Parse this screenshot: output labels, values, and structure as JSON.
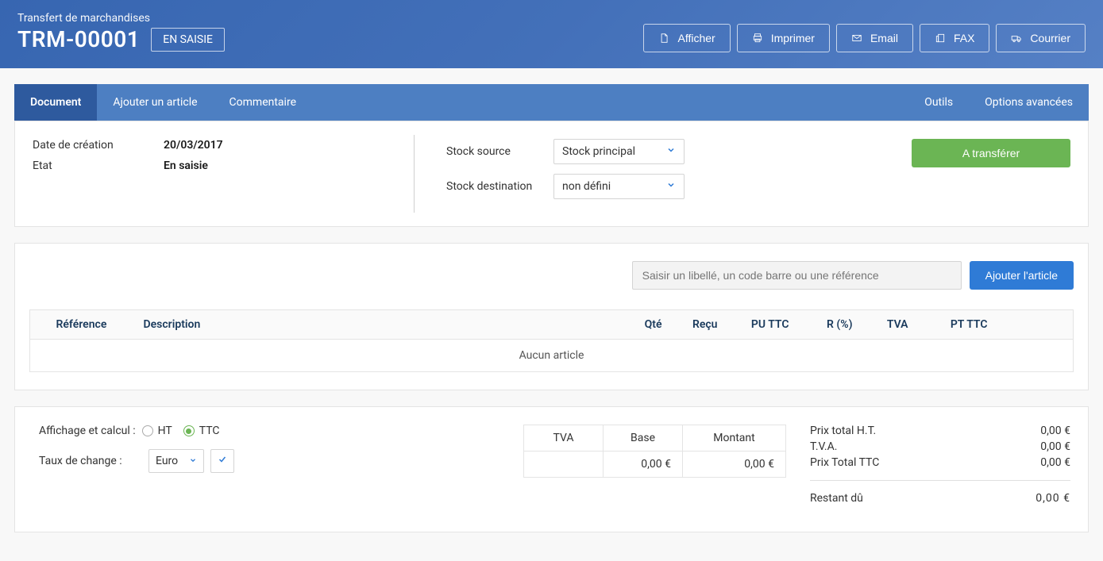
{
  "header": {
    "subtitle": "Transfert de marchandises",
    "title": "TRM-00001",
    "status": "EN SAISIE",
    "actions": {
      "afficher": "Afficher",
      "imprimer": "Imprimer",
      "email": "Email",
      "fax": "FAX",
      "courrier": "Courrier"
    }
  },
  "tabs": {
    "document": "Document",
    "ajouter": "Ajouter un article",
    "commentaire": "Commentaire",
    "outils": "Outils",
    "options": "Options avancées"
  },
  "info": {
    "date_label": "Date de création",
    "date_value": "20/03/2017",
    "etat_label": "Etat",
    "etat_value": "En saisie"
  },
  "stock": {
    "source_label": "Stock source",
    "source_value": "Stock principal",
    "dest_label": "Stock destination",
    "dest_value": "non défini"
  },
  "transfer_button": "A transférer",
  "articles": {
    "search_placeholder": "Saisir un libellé, un code barre ou une référence",
    "add_button": "Ajouter l'article",
    "columns": {
      "reference": "Référence",
      "description": "Description",
      "qte": "Qté",
      "recu": "Reçu",
      "pu_ttc": "PU TTC",
      "r_pct": "R (%)",
      "tva": "TVA",
      "pt_ttc": "PT TTC"
    },
    "empty": "Aucun article"
  },
  "calc": {
    "affichage_label": "Affichage et calcul :",
    "opt_ht": "HT",
    "opt_ttc": "TTC",
    "taux_label": "Taux de change :",
    "currency": "Euro"
  },
  "tva_table": {
    "h_tva": "TVA",
    "h_base": "Base",
    "h_montant": "Montant",
    "base": "0,00 €",
    "montant": "0,00 €"
  },
  "totals": {
    "ht_label": "Prix total H.T.",
    "ht_value": "0,00 €",
    "tva_label": "T.V.A.",
    "tva_value": "0,00 €",
    "ttc_label": "Prix Total TTC",
    "ttc_value": "0,00 €",
    "remain_label": "Restant dû",
    "remain_value": "0,00  €"
  }
}
